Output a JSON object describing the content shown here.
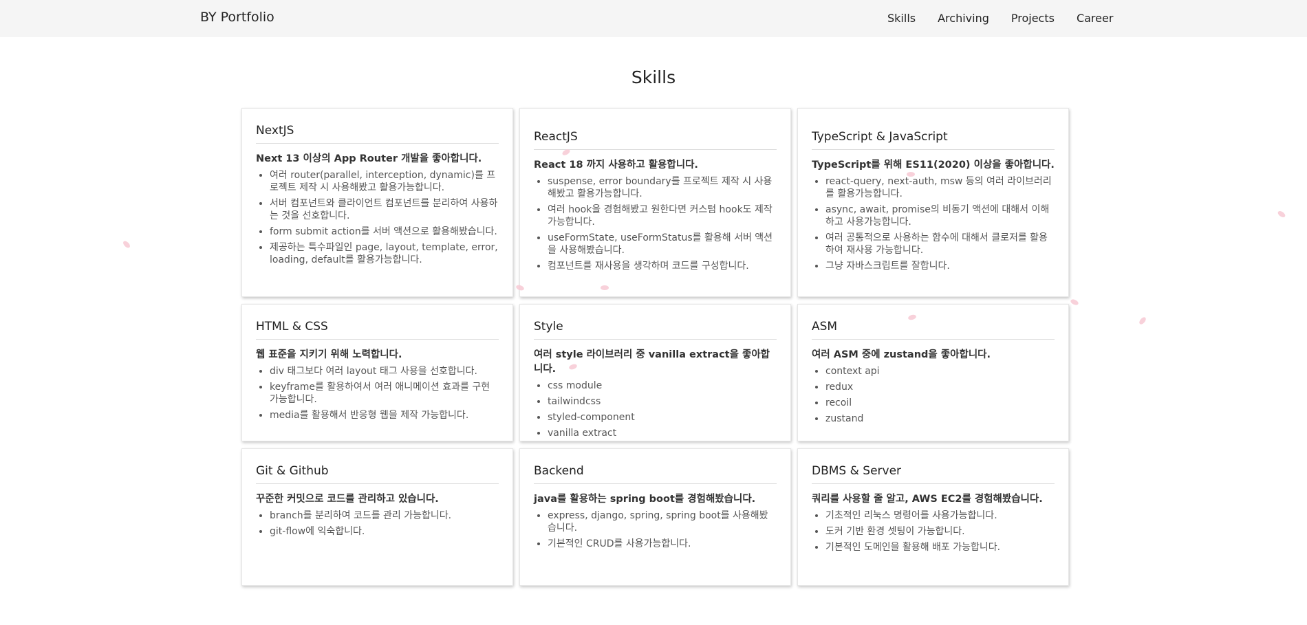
{
  "header": {
    "brand": "BY Portfolio",
    "nav": [
      "Skills",
      "Archiving",
      "Projects",
      "Career"
    ]
  },
  "section": {
    "title": "Skills"
  },
  "cards": [
    {
      "title": "NextJS",
      "subtitle": "Next 13 이상의 App Router 개발을 좋아합니다.",
      "items": [
        "여러 router(parallel, interception, dynamic)를 프로젝트 제작 시 사용해봤고 활용가능합니다.",
        "서버 컴포넌트와 클라이언트 컴포넌트를 분리하여 사용하는 것을 선호합니다.",
        "form submit action를 서버 액션으로 활용해봤습니다.",
        "제공하는 특수파일인 page, layout, template, error, loading, default를 활용가능합니다."
      ]
    },
    {
      "title": "ReactJS",
      "subtitle": "React 18 까지 사용하고 활용합니다.",
      "items": [
        "suspense, error boundary를 프로젝트 제작 시 사용해봤고 활용가능합니다.",
        "여러 hook을 경험해봤고 원한다면 커스텀 hook도 제작가능합니다.",
        "useFormState, useFormStatus를 활용해 서버 액션을 사용해봤습니다.",
        "컴포넌트를 재사용을 생각하며 코드를 구성합니다."
      ]
    },
    {
      "title": "TypeScript & JavaScript",
      "subtitle": "TypeScript를 위해 ES11(2020) 이상을 좋아합니다.",
      "items": [
        "react-query, next-auth, msw 등의 여러 라이브러리를 활용가능합니다.",
        "async, await, promise의 비동기 액션에 대해서 이해하고 사용가능합니다.",
        "여러 공통적으로 사용하는 함수에 대해서 클로저를 활용하여 재사용 가능합니다.",
        "그냥 자바스크립트를 잘합니다."
      ]
    },
    {
      "title": "HTML & CSS",
      "subtitle": "웹 표준을 지키기 위해 노력합니다.",
      "items": [
        "div 태그보다 여러 layout 태그 사용을 선호합니다.",
        "keyframe를 활용하여서 여러 애니메이션 효과를 구현 가능합니다.",
        "media를 활용해서 반응형 웹을 제작 가능합니다."
      ]
    },
    {
      "title": "Style",
      "subtitle": "여러 style 라이브러리 중 vanilla extract을 좋아합니다.",
      "items": [
        "css module",
        "tailwindcss",
        "styled-component",
        "vanilla extract"
      ]
    },
    {
      "title": "ASM",
      "subtitle": "여러 ASM 중에 zustand을 좋아합니다.",
      "items": [
        "context api",
        "redux",
        "recoil",
        "zustand"
      ]
    },
    {
      "title": "Git & Github",
      "subtitle": "꾸준한 커밋으로 코드를 관리하고 있습니다.",
      "items": [
        "branch를 분리하여 코드를 관리 가능합니다.",
        "git-flow에 익숙합니다."
      ]
    },
    {
      "title": "Backend",
      "subtitle": "java를 활용하는 spring boot를 경험해봤습니다.",
      "items": [
        "express, django, spring, spring boot를 사용해봤습니다.",
        "기본적인 CRUD를 사용가능합니다."
      ]
    },
    {
      "title": "DBMS & Server",
      "subtitle": "쿼리를 사용할 줄 알고, AWS EC2를 경험해봤습니다.",
      "items": [
        "기초적인 리눅스 명령어를 사용가능합니다.",
        "도커 기반 환경 셋팅이 가능합니다.",
        "기본적인 도메인을 활용해 배포 가능합니다."
      ]
    }
  ],
  "colors": {
    "header_bg": "#f5f5f5",
    "petal": "#f7c9d3"
  }
}
